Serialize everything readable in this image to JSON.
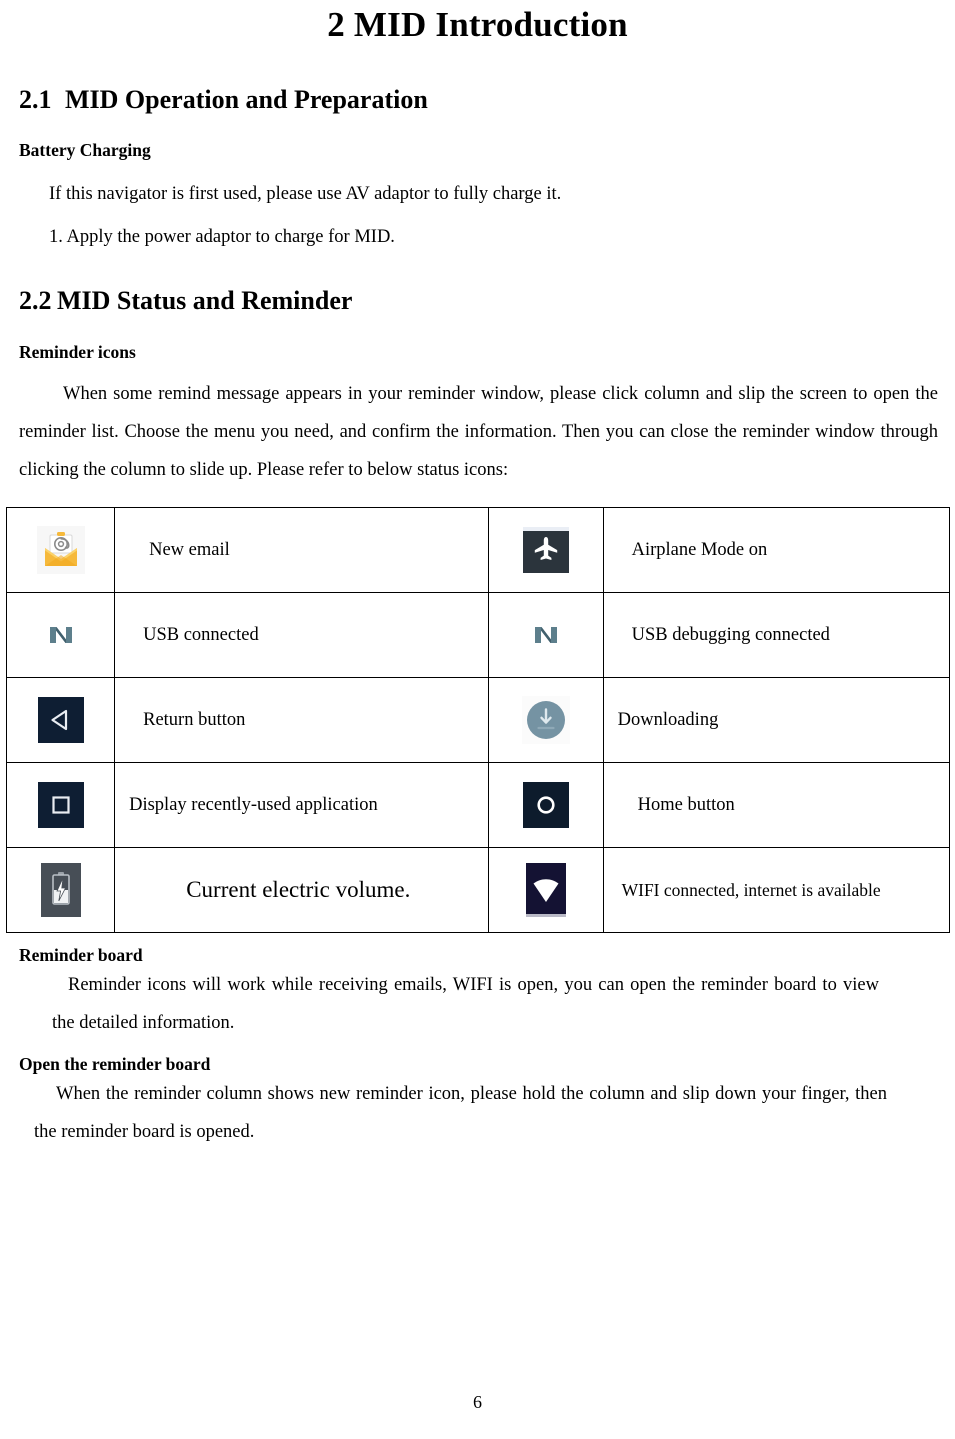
{
  "document": {
    "title": "2 MID Introduction",
    "page_number": "6"
  },
  "sections": {
    "s21": {
      "number": "2.1",
      "heading": "MID Operation and Preparation",
      "subheading": "Battery Charging",
      "line1": "If this navigator is first used, please use AV adaptor to fully charge it.",
      "line2": "1. Apply the power adaptor to charge for MID."
    },
    "s22": {
      "number": "2.2",
      "heading": "MID Status and Reminder",
      "subheading": "Reminder icons",
      "paragraph": "When some remind message appears in your reminder window, please click column and slip the screen to open the reminder list. Choose the menu you need, and confirm the information. Then you can close the reminder window through clicking the column to slide up. Please refer to below status icons:"
    },
    "reminder_board": {
      "subheading": "Reminder board",
      "paragraph": "Reminder icons will work while receiving emails, WIFI is open, you can open the reminder board to view the detailed information."
    },
    "open_reminder_board": {
      "subheading": "Open the reminder board",
      "paragraph": "When the reminder column shows new reminder icon, please hold the column and slip down your finger, then the reminder board is opened."
    }
  },
  "status_table": {
    "rows": [
      {
        "left_icon": "new-email-icon",
        "left_label": "New email",
        "right_icon": "airplane-mode-icon",
        "right_label": "Airplane Mode on"
      },
      {
        "left_icon": "usb-connected-icon",
        "left_label": "USB connected",
        "right_icon": "usb-debugging-icon",
        "right_label": "USB debugging connected"
      },
      {
        "left_icon": "return-button-icon",
        "left_label": "Return button",
        "right_icon": "downloading-icon",
        "right_label": "Downloading"
      },
      {
        "left_icon": "recent-apps-icon",
        "left_label": "Display recently-used application",
        "right_icon": "home-button-icon",
        "right_label": "Home button"
      },
      {
        "left_icon": "battery-charging-icon",
        "left_label": "Current electric volume.",
        "right_icon": "wifi-connected-icon",
        "right_label": "WIFI connected, internet is available"
      }
    ]
  },
  "colors": {
    "email_envelope": "#f6b93b",
    "email_envelope_dark": "#f0a81e",
    "android_n": "#5d7f8c",
    "nav_dark": "#2b343c",
    "nav_navy": "#0e1e33",
    "nav_navy_deep": "#0d1b2c",
    "download_circle": "#7593a3",
    "battery_bg": "#474e56",
    "wifi_bg": "#141233",
    "text": "#000000",
    "border": "#000000"
  }
}
